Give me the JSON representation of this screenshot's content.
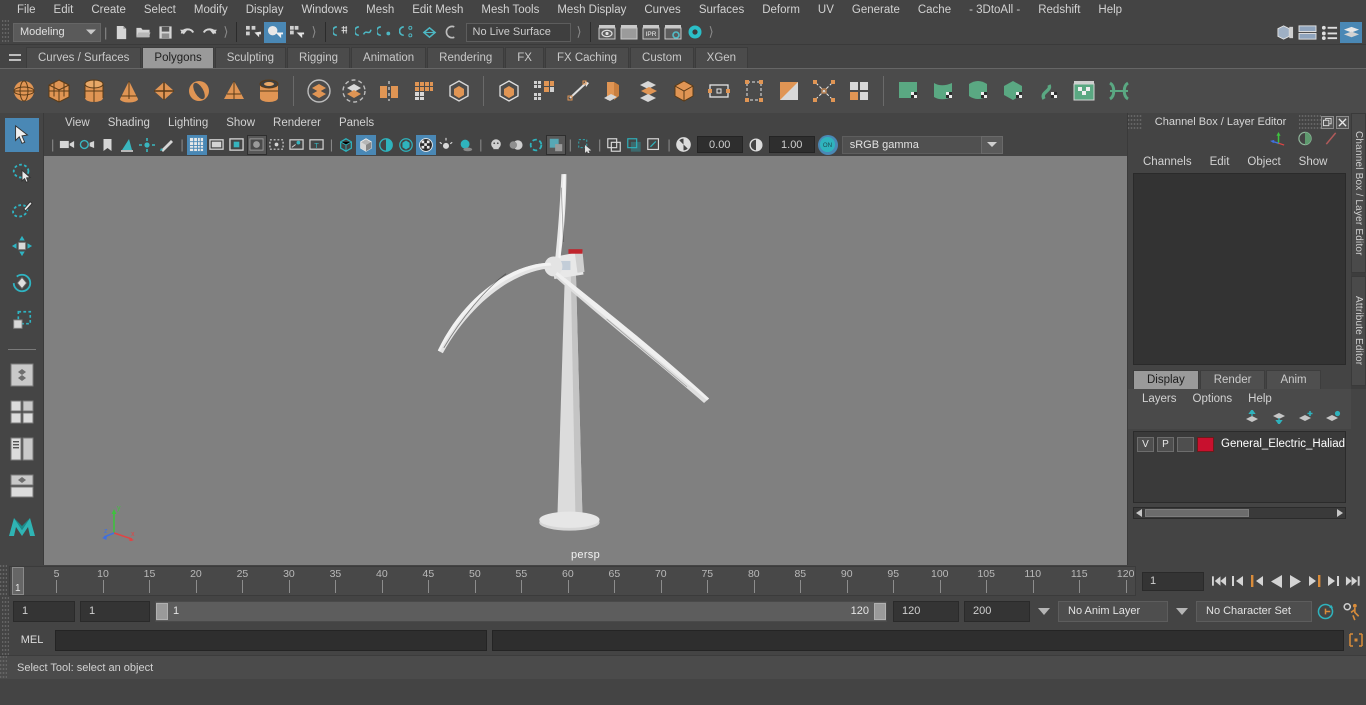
{
  "menubar": {
    "items": [
      "File",
      "Edit",
      "Create",
      "Select",
      "Modify",
      "Display",
      "Windows",
      "Mesh",
      "Edit Mesh",
      "Mesh Tools",
      "Mesh Display",
      "Curves",
      "Surfaces",
      "Deform",
      "UV",
      "Generate",
      "Cache",
      "- 3DtoAll -",
      "Redshift",
      "Help"
    ]
  },
  "status_line": {
    "menu_set": "Modeling",
    "live_surface": "No Live Surface",
    "icons_left": [
      "new-scene-icon",
      "open-scene-icon",
      "save-scene-icon",
      "undo-icon",
      "redo-icon"
    ],
    "select_modes": [
      "select-by-hierarchy-icon",
      "select-by-object-type-icon",
      "select-by-component-type-icon"
    ],
    "snap_icons": [
      "snap-to-grid-icon",
      "snap-to-curve-icon",
      "snap-to-point-icon",
      "snap-to-projected-center-icon",
      "snap-to-view-plane-icon",
      "make-live-icon"
    ],
    "render_icons": [
      "render-current-frame-icon",
      "render-sequence-icon",
      "ipr-render-icon",
      "render-settings-icon",
      "hypershade-icon"
    ],
    "right_icons": [
      "show-hide-modeling-editors-icon",
      "show-hide-attribute-editor-icon",
      "show-hide-tool-settings-icon",
      "show-hide-channel-box-icon"
    ]
  },
  "shelf": {
    "tabs": [
      "Curves / Surfaces",
      "Polygons",
      "Sculpting",
      "Rigging",
      "Animation",
      "Rendering",
      "FX",
      "FX Caching",
      "Custom",
      "XGen"
    ],
    "active_tab": "Polygons",
    "buttons": [
      "poly-sphere-icon",
      "poly-cube-icon",
      "poly-cylinder-icon",
      "poly-cone-icon",
      "poly-plane-icon",
      "poly-torus-icon",
      "poly-pyramid-icon",
      "poly-pipe-icon",
      "combine-icon",
      "separate-icon",
      "mirror-icon",
      "smooth-icon",
      "boolean-icon",
      "extrude-icon",
      "multi-cut-icon",
      "bevel-icon",
      "bridge-icon",
      "append-icon",
      "target-weld-icon",
      "insert-edge-loop-icon",
      "quad-draw-icon",
      "offset-edge-loop-icon",
      "multi-color-icon",
      "uv-planar-icon",
      "uv-cylindrical-icon",
      "uv-spherical-icon",
      "uv-automatic-icon",
      "uv-unfold-icon",
      "uv-editor-icon",
      "uv-cut-icon"
    ]
  },
  "toolbox": {
    "tools": [
      "select-tool",
      "lasso-select-tool",
      "paint-select-tool",
      "move-tool",
      "rotate-tool",
      "scale-tool",
      "last-tool-used",
      "quick-layout-single",
      "quick-layout-four",
      "quick-layout-outliner",
      "quick-layout-graph",
      "maya-logo-icon"
    ],
    "active_tool": "select-tool"
  },
  "viewport": {
    "menus": [
      "View",
      "Shading",
      "Lighting",
      "Show",
      "Renderer",
      "Panels"
    ],
    "toolbar_icons": [
      "select-camera-icon",
      "camera-attributes-icon",
      "bookmark-icon",
      "image-plane-icon",
      "2d-pan-zoom-icon",
      "grease-pencil-icon",
      "grid-icon",
      "film-gate-icon",
      "resolution-gate-icon",
      "gate-mask-icon",
      "film-origin-icon",
      "xray-joints-icon",
      "texture-border-icon",
      "wireframe-icon",
      "smooth-shade-icon",
      "shaded-wireframe-icon",
      "hardware-texture-icon",
      "use-default-light-icon",
      "shadows-icon",
      "screen-space-ao-icon",
      "motion-blur-icon",
      "multisample-icon",
      "depth-of-field-icon",
      "isolate-select-icon",
      "xray-icon",
      "xray-active-icon",
      "xray-joints2-icon"
    ],
    "exposure_value": "0.00",
    "gamma_value": "1.00",
    "color_space": "sRGB gamma",
    "color_mgmt_toggle": "ON",
    "camera_label": "persp",
    "axis_labels": [
      "y",
      "x",
      "z"
    ],
    "background_color": "#808080"
  },
  "channel_box": {
    "title": "Channel Box / Layer Editor",
    "menus": [
      "Channels",
      "Edit",
      "Object",
      "Show"
    ],
    "header_icons": [
      "restore-panel-icon",
      "close-panel-icon"
    ],
    "toggle_icons": [
      "show-manipulators-icon",
      "show-hidden-icon",
      "speed-icon"
    ],
    "side_tabs": [
      "Channel Box / Layer Editor",
      "Attribute Editor"
    ]
  },
  "layer_editor": {
    "tabs": [
      "Display",
      "Render",
      "Anim"
    ],
    "active_tab": "Display",
    "menus": [
      "Layers",
      "Options",
      "Help"
    ],
    "buttons": [
      "move-layer-up-icon",
      "move-layer-down-icon",
      "create-new-layer-icon",
      "create-layer-from-selected-icon"
    ],
    "layers": [
      {
        "visibility": "V",
        "playback": "P",
        "shading": "",
        "color": "#c8102e",
        "name": "General_Electric_Haliad"
      }
    ]
  },
  "timeline": {
    "start_label": "1",
    "ticks": [
      5,
      10,
      15,
      20,
      25,
      30,
      35,
      40,
      45,
      50,
      55,
      60,
      65,
      70,
      75,
      80,
      85,
      90,
      95,
      100,
      105,
      110,
      115,
      120
    ],
    "current_frame": "1",
    "frame_field": "1",
    "playback_buttons": [
      "go-to-start-icon",
      "step-back-keyframe-icon",
      "step-back-frame-icon",
      "play-backwards-icon",
      "play-forwards-icon",
      "step-forward-frame-icon",
      "step-forward-keyframe-icon",
      "go-to-end-icon"
    ]
  },
  "range_slider": {
    "anim_start": "1",
    "range_start": "1",
    "range_bar_start": "1",
    "range_bar_end": "120",
    "range_end": "120",
    "anim_end": "200",
    "anim_layer": "No Anim Layer",
    "character_set": "No Character Set",
    "auto_key_icon": "auto-keyframe-icon",
    "pref_icon": "animation-preferences-icon"
  },
  "command_line": {
    "language": "MEL",
    "input_value": "",
    "output_value": "",
    "script_editor_icon": "script-editor-icon"
  },
  "help_line": {
    "text": "Select Tool: select an object"
  }
}
